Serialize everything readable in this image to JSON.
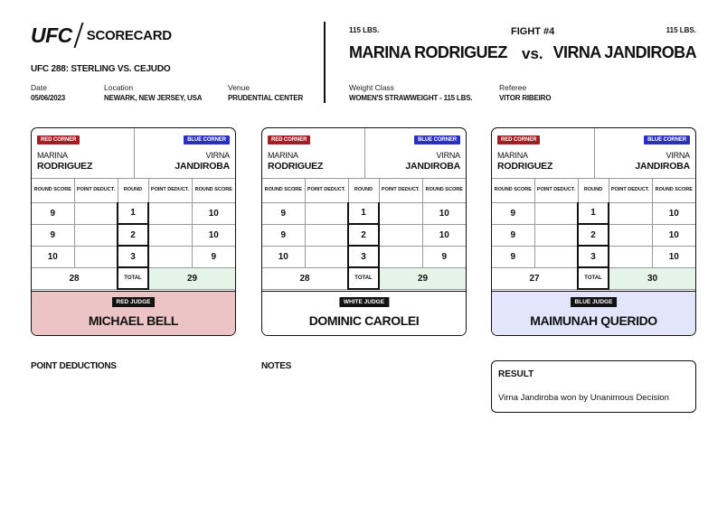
{
  "header": {
    "logo_text": "UFC",
    "scorecard_label": "SCORECARD",
    "event": "UFC 288: STERLING VS. CEJUDO",
    "date_label": "Date",
    "date": "05/06/2023",
    "location_label": "Location",
    "location": "NEWARK, NEW JERSEY, USA",
    "venue_label": "Venue",
    "venue": "PRUDENTIAL CENTER"
  },
  "fight": {
    "number": "FIGHT #4",
    "red_weight": "115 LBS.",
    "blue_weight": "115 LBS.",
    "red_fighter": "MARINA RODRIGUEZ",
    "vs": "vs.",
    "blue_fighter": "VIRNA JANDIROBA",
    "weight_class_label": "Weight Class",
    "weight_class": "WOMEN'S STRAWWEIGHT - 115 LBS.",
    "referee_label": "Referee",
    "referee": "VITOR RIBEIRO"
  },
  "columns": {
    "red_score": "ROUND SCORE",
    "red_deduct": "POINT DEDUCT.",
    "round": "ROUND",
    "blue_deduct": "POINT DEDUCT.",
    "blue_score": "ROUND SCORE",
    "total": "TOTAL"
  },
  "corners": {
    "red_label": "RED CORNER",
    "blue_label": "BLUE CORNER",
    "red_first": "MARINA",
    "red_last": "RODRIGUEZ",
    "blue_first": "VIRNA",
    "blue_last": "JANDIROBA"
  },
  "judges": [
    {
      "badge": "RED JUDGE",
      "name": "MICHAEL BELL",
      "panel_color": "#ecc4c6",
      "rounds": [
        {
          "red": "9",
          "red_deduct": "",
          "round": "1",
          "blue_deduct": "",
          "blue": "10"
        },
        {
          "red": "9",
          "red_deduct": "",
          "round": "2",
          "blue_deduct": "",
          "blue": "10"
        },
        {
          "red": "10",
          "red_deduct": "",
          "round": "3",
          "blue_deduct": "",
          "blue": "9"
        }
      ],
      "red_total": "28",
      "blue_total": "29"
    },
    {
      "badge": "WHITE JUDGE",
      "name": "DOMINIC CAROLEI",
      "panel_color": "#ffffff",
      "rounds": [
        {
          "red": "9",
          "red_deduct": "",
          "round": "1",
          "blue_deduct": "",
          "blue": "10"
        },
        {
          "red": "9",
          "red_deduct": "",
          "round": "2",
          "blue_deduct": "",
          "blue": "10"
        },
        {
          "red": "10",
          "red_deduct": "",
          "round": "3",
          "blue_deduct": "",
          "blue": "9"
        }
      ],
      "red_total": "28",
      "blue_total": "29"
    },
    {
      "badge": "BLUE JUDGE",
      "name": "MAIMUNAH QUERIDO",
      "panel_color": "#e2e5fb",
      "rounds": [
        {
          "red": "9",
          "red_deduct": "",
          "round": "1",
          "blue_deduct": "",
          "blue": "10"
        },
        {
          "red": "9",
          "red_deduct": "",
          "round": "2",
          "blue_deduct": "",
          "blue": "10"
        },
        {
          "red": "9",
          "red_deduct": "",
          "round": "3",
          "blue_deduct": "",
          "blue": "10"
        }
      ],
      "red_total": "27",
      "blue_total": "30"
    }
  ],
  "sections": {
    "deductions": "POINT DEDUCTIONS",
    "notes": "NOTES"
  },
  "result": {
    "title": "RESULT",
    "text": "Virna Jandiroba won by Unanimous Decision"
  }
}
